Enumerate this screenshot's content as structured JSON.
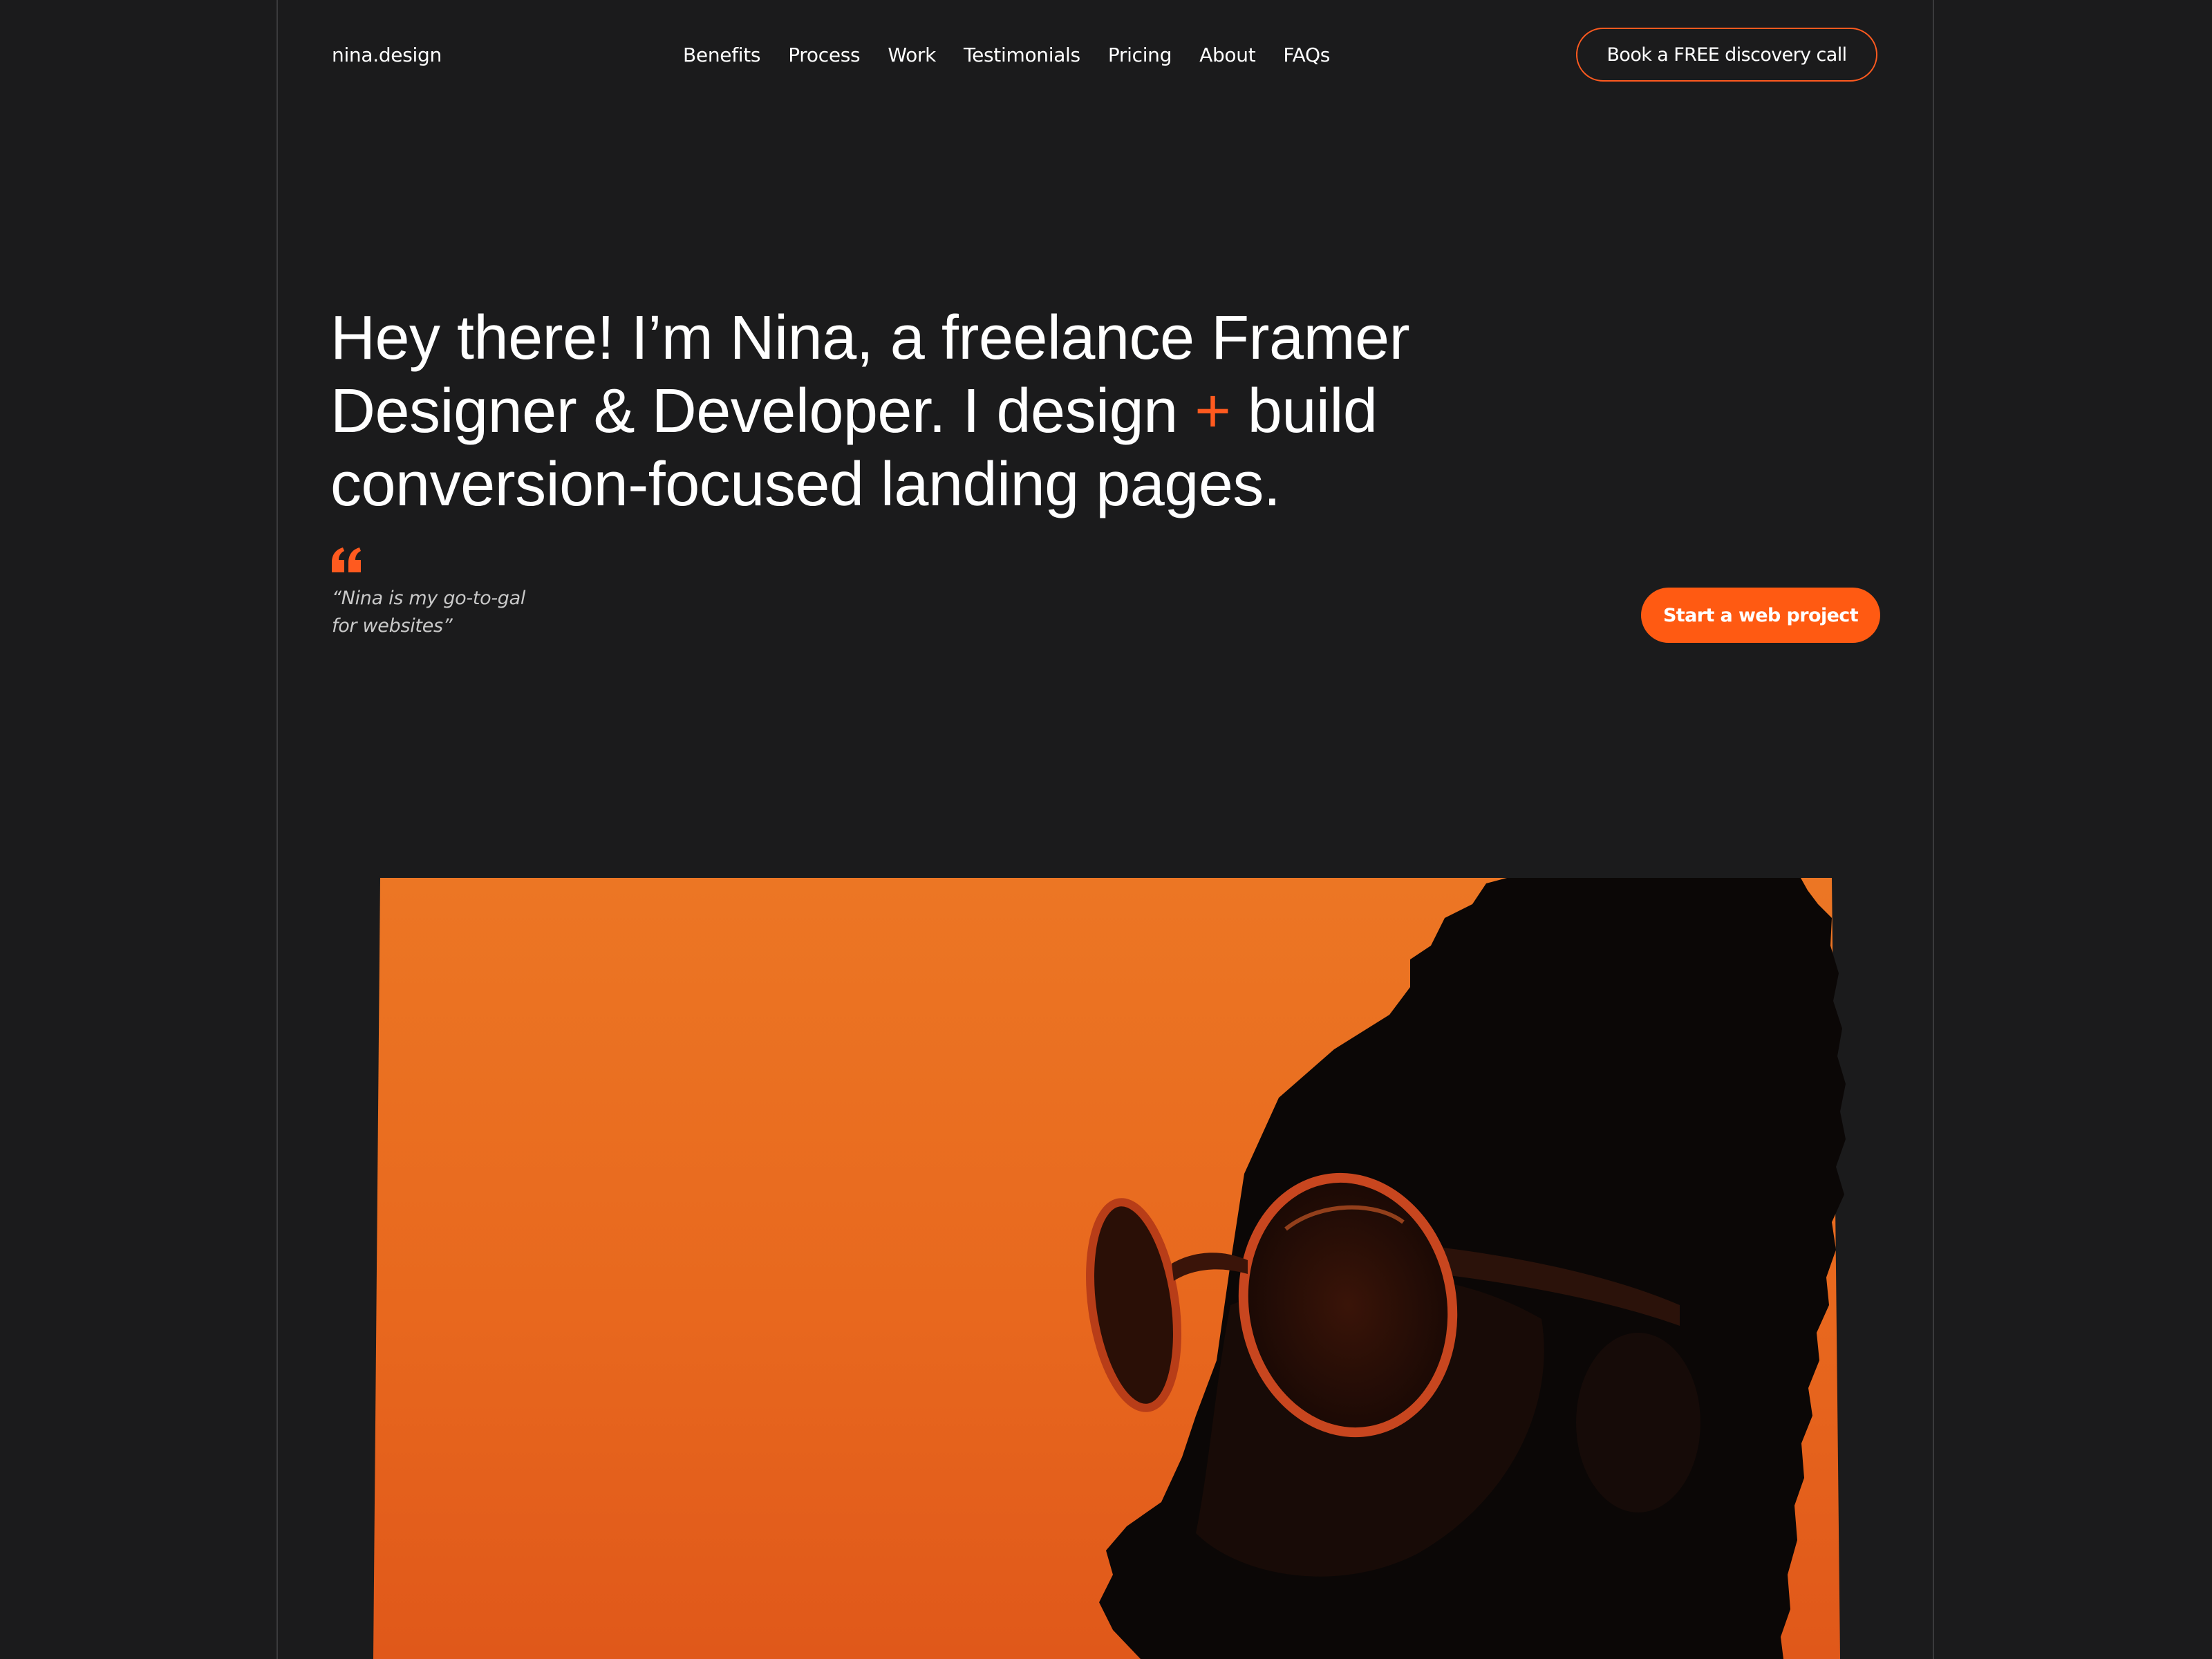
{
  "site": {
    "logo": "nina.design"
  },
  "nav": {
    "items": [
      {
        "label": "Benefits"
      },
      {
        "label": "Process"
      },
      {
        "label": "Work"
      },
      {
        "label": "Testimonials"
      },
      {
        "label": "Pricing"
      },
      {
        "label": "About"
      },
      {
        "label": "FAQs"
      }
    ],
    "cta_label": "Book a FREE discovery call"
  },
  "hero": {
    "headline_part1": "Hey there! I’m Nina, a freelance Framer Designer & Developer. I design ",
    "headline_plus": "+",
    "headline_part2": " build conversion-focused landing pages.",
    "quote_line1": "“Nina is my go-to-gal",
    "quote_line2": "for websites”",
    "primary_cta": "Start a web project"
  },
  "hero_image": {
    "icon": "portrait-photo"
  },
  "colors": {
    "background": "#1b1b1c",
    "accent": "#ff5a1f",
    "text": "#ffffff"
  }
}
